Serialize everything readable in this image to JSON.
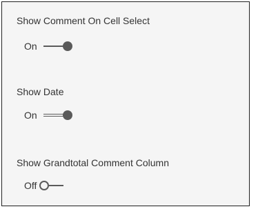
{
  "settings": [
    {
      "label": "Show Comment On Cell Select",
      "state_label": "On",
      "on": true
    },
    {
      "label": "Show Date",
      "state_label": "On",
      "on": true
    },
    {
      "label": "Show Grandtotal Comment Column",
      "state_label": "Off",
      "on": false
    }
  ],
  "colors": {
    "panel_background": "#f5f5f5",
    "panel_border": "#1f1f1f",
    "text": "#333333",
    "toggle": "#5a5a5a"
  }
}
